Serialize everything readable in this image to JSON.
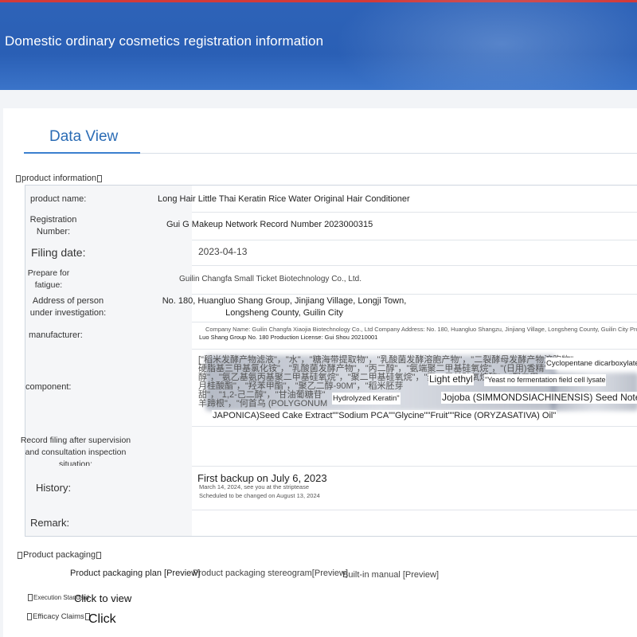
{
  "banner": {
    "title": "Domestic ordinary cosmetics registration information"
  },
  "tabs": {
    "active": "Data View"
  },
  "product_info": {
    "section_title": "product information",
    "rows": {
      "name": {
        "label": "product name:",
        "value": "Long Hair Little Thai Keratin Rice Water Original Hair Conditioner"
      },
      "registration": {
        "label": "Registration Number:",
        "value": "Gui G Makeup Network Record Number 2023000315"
      },
      "filing_date": {
        "label": "Filing date:",
        "value": "2023-04-13"
      },
      "prepare": {
        "label": "Prepare for fatigue:",
        "value": "Guilin Changfa Small Ticket Biotechnology Co., Ltd."
      },
      "address": {
        "label": "Address of person under investigation:",
        "value": "No. 180, Huangluo Shang Group, Jinjiang Village, Longji Town, Longsheng County, Guilin City"
      },
      "manufacturer": {
        "label": "manufacturer:",
        "value_line1": "Company Name: Guilin Changfa Xiaojia Biotechnology Co., Ltd  Company Address: No. 180, Huangluo Shangzu, Jinjiang Village, Longsheng County, Guilin City Production A",
        "value_line2": "Luo Shang Group No. 180 Production License: Gui Shou 20210001"
      },
      "component": {
        "label": "component:",
        "cn_line1": "[\"稻米发酵产物滤液\"，\"水\"，\"糖海带提取物\"，\"乳酸菌发酵溶胞产物\"，\"二裂酵母发酵产物溶胞物\"",
        "cn_line2": "硬脂基三甲基氯化铵\"，\"乳酸菌发酵产物\"，\"丙二醇\"，\"氨端聚二甲基硅氧烷\"，\"(日用)香精\"",
        "cn_line3": "醇\"，\"氨乙基氨丙基聚二甲基硅氧烷\"，\"聚二甲基硅氧烷\"，\"聚二甲基硅氧烷醇\"，\"聚二甲",
        "cn_line4": "月桂酸酯\"，\"羟苯甲酯\"，\"聚乙二醇-90M\"，\"稻米胚芽",
        "cn_line5": "甜\"，\"1,2-己二醇\"，\"甘油葡糖苷\"",
        "cn_line6": "羊蹄根\"，\"何首乌 (POLYGONUM",
        "en_cyclopentane": "Cyclopentane dicarboxylate",
        "en_light_ethyl": "Light ethyl",
        "en_yeast": "\"Yeast no fermentation field cell lysate",
        "en_hydrolyzed": "Hydrolyzed Keratin\"",
        "en_jojoba": "Jojoba (SIMMONDSIACHINENSIS) Seed Note",
        "en_line_last": "JAPONICA)Seed Cake Extract\"\"Sodium PCA\"\"Glycine\"\"Fruit\"\"Rice (ORYZASATIVA) Oil\""
      },
      "record_filing": {
        "label": "Record filing after supervision and consultation inspection situation:"
      },
      "history": {
        "label": "History:",
        "main": "First backup on July 6, 2023",
        "sub1": "March 14, 2024, see you at the striptease",
        "sub2": "Scheduled to be changed on August 13, 2024"
      },
      "remark": {
        "label": "Remark:"
      }
    }
  },
  "packaging": {
    "section_title": "Product packaging",
    "links": {
      "plan": "Product packaging plan [Preview]",
      "stereogram": "Product packaging stereogram[Preview]",
      "manual": "Built-in manual [Preview]"
    }
  },
  "execution": {
    "label": "Execution Standard",
    "action": "Click to view"
  },
  "efficacy": {
    "label": "Efficacy Claims",
    "action": "Click"
  }
}
